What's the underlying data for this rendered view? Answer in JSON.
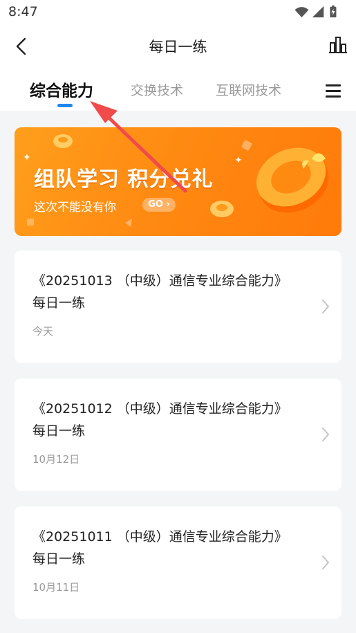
{
  "status": {
    "time": "8:47"
  },
  "header": {
    "title": "每日一练"
  },
  "tabs": [
    {
      "label": "综合能力",
      "active": true
    },
    {
      "label": "交换技术",
      "active": false
    },
    {
      "label": "互联网技术",
      "active": false
    }
  ],
  "banner": {
    "title": "组队学习 积分兑礼",
    "subtitle": "这次不能没有你",
    "go_label": "GO"
  },
  "items": [
    {
      "title": "《20251013 （中级）通信专业综合能力》每日一练",
      "date": "今天"
    },
    {
      "title": "《20251012 （中级）通信专业综合能力》每日一练",
      "date": "10月12日"
    },
    {
      "title": "《20251011 （中级）通信专业综合能力》每日一练",
      "date": "10月11日"
    }
  ],
  "colors": {
    "accent": "#1e88f0",
    "banner_orange": "#ff8a12",
    "annotation_red": "#f04a4a"
  },
  "icons": [
    "back-icon",
    "bar-chart-icon",
    "menu-icon",
    "chevron-right-icon",
    "wifi-icon",
    "signal-icon",
    "battery-icon"
  ]
}
